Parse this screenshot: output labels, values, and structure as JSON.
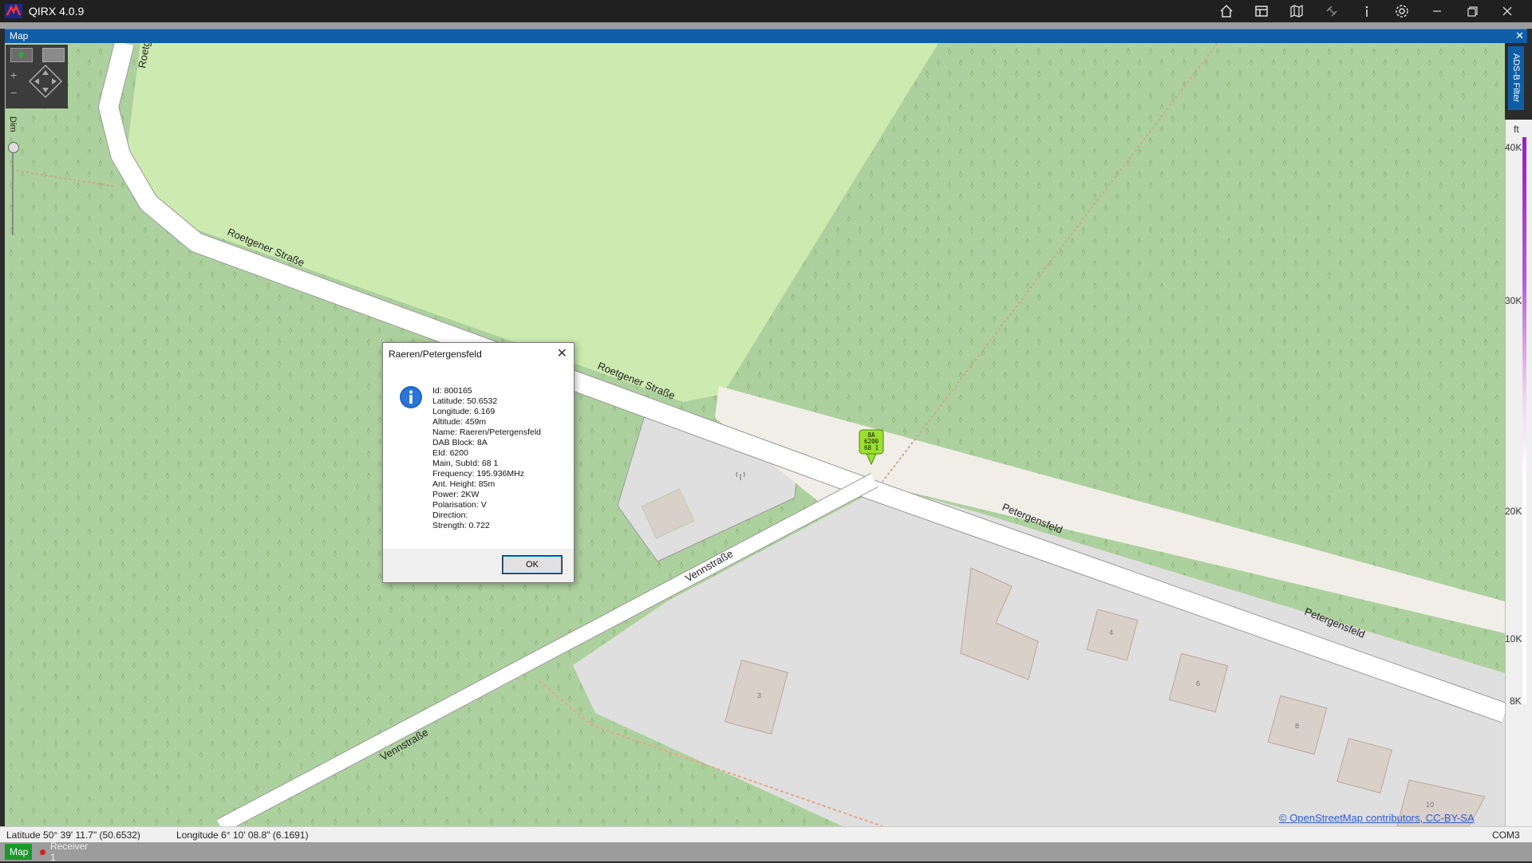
{
  "window": {
    "title": "QIRX 4.0.9",
    "toolbar_icons": [
      "home-icon",
      "layout-icon",
      "map-icon",
      "satellite-icon",
      "info-icon",
      "gear-icon",
      "minimize-icon",
      "maximize-icon",
      "close-icon"
    ]
  },
  "panel": {
    "title": "Map",
    "close": "✕"
  },
  "map": {
    "dim_label": "Dim",
    "adsb_filter": "ADS-B Filter",
    "altitude_unit": "ft",
    "altitude_ticks": [
      "40K",
      "30K",
      "20K",
      "10K",
      "8K"
    ],
    "street_labels": {
      "roetgener_1": "Roetgener Straße",
      "roetgener_2": "Roetgener Straße",
      "roetgener_top": "Roetg",
      "petergensfeld_1": "Petergensfeld",
      "petergensfeld_2": "Petergensfeld",
      "vennstrasse_1": "Vennstraße",
      "vennstrasse_2": "Vennstraße"
    },
    "house_numbers": [
      "3",
      "4",
      "6",
      "8",
      "10"
    ],
    "marker": {
      "line1": "8A",
      "line2": "6200",
      "line3": "68 1"
    },
    "attribution": "© OpenStreetMap contributors, CC-BY-SA"
  },
  "dialog": {
    "title": "Raeren/Petergensfeld",
    "lines": [
      "Id: 800165",
      "Latitude: 50.6532",
      "Longitude: 6.169",
      "Altitude: 459m",
      "Name: Raeren/Petergensfeld",
      "DAB Block: 8A",
      "EId: 6200",
      "Main, SubId: 68 1",
      "Frequency: 195.936MHz",
      "Ant. Height: 85m",
      "Power: 2KW",
      "Polarisation: V",
      "Direction:",
      "Strength: 0.722"
    ],
    "ok_label": "OK"
  },
  "status": {
    "latitude": "Latitude  50° 39' 11.7\" (50.6532)",
    "longitude": "Longitude  6° 10' 08.8\" (6.1691)",
    "port": "COM3"
  },
  "tabs": {
    "map": "Map",
    "receiver": "Receiver 1"
  }
}
